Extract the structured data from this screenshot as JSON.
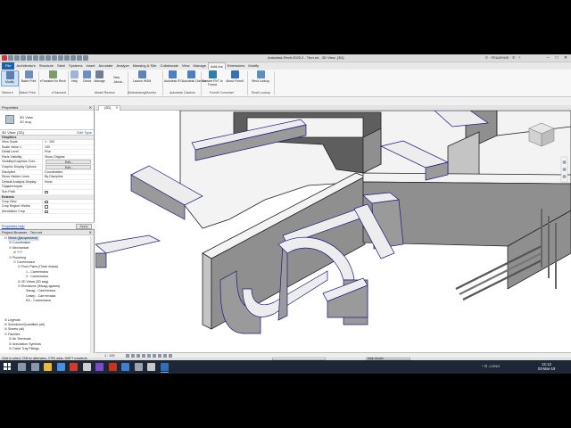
{
  "window": {
    "title": "Autodesk Revit 2020.2 - Тест.rvt - 3D View: {3D}",
    "user_area": "© · РЕШЕНИЕ · ✆ · ?",
    "controls": [
      "–",
      "□",
      "✕"
    ]
  },
  "ribbon": {
    "tabs": [
      {
        "label": "File",
        "kind": "file"
      },
      {
        "label": "Architecture"
      },
      {
        "label": "Structure"
      },
      {
        "label": "Steel"
      },
      {
        "label": "Systems"
      },
      {
        "label": "Insert"
      },
      {
        "label": "Annotate"
      },
      {
        "label": "Analyze"
      },
      {
        "label": "Massing & Site"
      },
      {
        "label": "Collaborate"
      },
      {
        "label": "View"
      },
      {
        "label": "Manage"
      },
      {
        "label": "Add-Ins",
        "kind": "active"
      },
      {
        "label": "Extensions"
      },
      {
        "label": "Modify"
      }
    ],
    "buttons": {
      "modify": "Modify",
      "batch_print": "Batch Print",
      "eTransmit": "eTransmit for Revit",
      "help": "Help",
      "check": "Check",
      "manage": "Manage",
      "view": "View",
      "about": "About...",
      "launch": "Launch WSM",
      "autodesk_ifc_1": "Autodesk IFC",
      "autodesk_ifc_2": "Autodesk Clashes",
      "convert_rvt": "Convert RVT to Forma",
      "about_formit": "About FormIt",
      "revit_lookup": "Revit Lookup"
    },
    "groups": {
      "select": "Select ▾",
      "batch_print": "Batch Print",
      "etransmit": "eTransmit",
      "model_review": "Model Review",
      "worksharing": "WorksharingMonitor",
      "autodesk_clashes": "Autodesk Clashes",
      "formit": "FormIt Converter",
      "revit_lookup": "Revit Lookup"
    }
  },
  "properties": {
    "header": "Properties",
    "close": "✕",
    "type_name": "3D View",
    "type_sub": "3D вид",
    "instance_label": "3D View: {3D}",
    "edit_type": "Edit Type",
    "section_graphics": "Graphics",
    "rows": [
      {
        "k": "View Scale",
        "v": "1 : 100",
        "kind": "text"
      },
      {
        "k": "Scale Value    1:",
        "v": "100",
        "kind": "text"
      },
      {
        "k": "Detail Level",
        "v": "Fine",
        "kind": "text"
      },
      {
        "k": "Parts Visibility",
        "v": "Show Original",
        "kind": "text"
      },
      {
        "k": "Visibility/Graphics Over...",
        "v": "Edit...",
        "kind": "btn"
      },
      {
        "k": "Graphic Display Options",
        "v": "Edit...",
        "kind": "btn"
      },
      {
        "k": "Discipline",
        "v": "Coordination",
        "kind": "text"
      },
      {
        "k": "Show Hidden Lines",
        "v": "By Discipline",
        "kind": "text"
      },
      {
        "k": "Default Analysis Display...",
        "v": "None",
        "kind": "text"
      },
      {
        "k": "Подкатегория",
        "v": "",
        "kind": "text"
      },
      {
        "k": "Sun Path",
        "v": "",
        "kind": "chk"
      }
    ],
    "section_extents": "Extents",
    "rows2": [
      {
        "k": "Crop View",
        "v": "",
        "kind": "chk"
      },
      {
        "k": "Crop Region Visible",
        "v": "",
        "kind": "chk"
      },
      {
        "k": "Annotation Crop",
        "v": "",
        "kind": "chk"
      }
    ],
    "help": "Properties help",
    "apply": "Apply"
  },
  "browser": {
    "header": "Project Browser - Тест.rvt",
    "close": "✕",
    "tree": [
      {
        "label": "Views (Дисциплина)",
        "toggle": "⊟",
        "indent": 1,
        "hl": true
      },
      {
        "label": "Coordination",
        "toggle": "⊞",
        "indent": 2
      },
      {
        "label": "Mechanical",
        "toggle": "⊟",
        "indent": 2
      },
      {
        "label": "???",
        "toggle": "⊞",
        "indent": 3
      },
      {
        "label": "Plumbing",
        "toggle": "⊟",
        "indent": 2
      },
      {
        "label": "Сантехника",
        "toggle": "⊟",
        "indent": 3
      },
      {
        "label": "Floor Plans (План этажа)",
        "toggle": "⊟",
        "indent": 4
      },
      {
        "label": "1 - Сантехника",
        "toggle": "",
        "indent": 5
      },
      {
        "label": "2 - Сантехника",
        "toggle": "",
        "indent": 5
      },
      {
        "label": "3D Views (3D вид)",
        "toggle": "⊞",
        "indent": 4
      },
      {
        "label": "Elevations (Фасад здания)",
        "toggle": "⊟",
        "indent": 4
      },
      {
        "label": "Запад - Сантехника",
        "toggle": "",
        "indent": 5
      },
      {
        "label": "Север - Сантехника",
        "toggle": "",
        "indent": 5
      },
      {
        "label": "Юг - Сантехника",
        "toggle": "",
        "indent": 5
      },
      {
        "label": "",
        "toggle": "",
        "indent": 5
      },
      {
        "label": "",
        "toggle": "",
        "indent": 5
      },
      {
        "label": "",
        "toggle": "",
        "indent": 5
      },
      {
        "label": "Legends",
        "toggle": "⊞",
        "indent": 1
      },
      {
        "label": "Schedules/Quantities (all)",
        "toggle": "⊞",
        "indent": 1
      },
      {
        "label": "Sheets (all)",
        "toggle": "⊞",
        "indent": 1
      },
      {
        "label": "Families",
        "toggle": "⊟",
        "indent": 1
      },
      {
        "label": "Air Terminals",
        "toggle": "⊞",
        "indent": 2
      },
      {
        "label": "Annotation Symbols",
        "toggle": "⊞",
        "indent": 2
      },
      {
        "label": "Cable Tray Fittings",
        "toggle": "⊞",
        "indent": 2
      }
    ]
  },
  "view": {
    "tab_label": "{3D}",
    "tab_close": "✕",
    "scale": "1 : 100"
  },
  "status": {
    "text": "Click to select, TAB for alternates, CTRL adds, SHIFT unselects.",
    "main_model": "Main Model"
  },
  "taskbar": {
    "icons": [
      {
        "name": "search-icon",
        "color": "#8a97ab"
      },
      {
        "name": "task-view-icon",
        "color": "#8a97ab"
      },
      {
        "name": "file-explorer-icon",
        "color": "#e8b93a"
      },
      {
        "name": "chrome-icon",
        "color": "#4a8fe0"
      },
      {
        "name": "autocad-icon",
        "color": "#d23a2a"
      },
      {
        "name": "app-icon",
        "color": "#cfcfcf"
      },
      {
        "name": "visual-studio-icon",
        "color": "#7b4ac9"
      },
      {
        "name": "pdf-icon",
        "color": "#c8351f"
      },
      {
        "name": "photos-icon",
        "color": "#3f7fcf"
      },
      {
        "name": "settings-icon",
        "color": "#9aa3b0"
      },
      {
        "name": "office-icon",
        "color": "#c8c8c8"
      },
      {
        "name": "revit-icon",
        "color": "#2f6fb5",
        "open": true
      }
    ],
    "tray": "^ ⊡ ◁ ENG",
    "time": "21:12",
    "date": "03-Mar-19"
  }
}
